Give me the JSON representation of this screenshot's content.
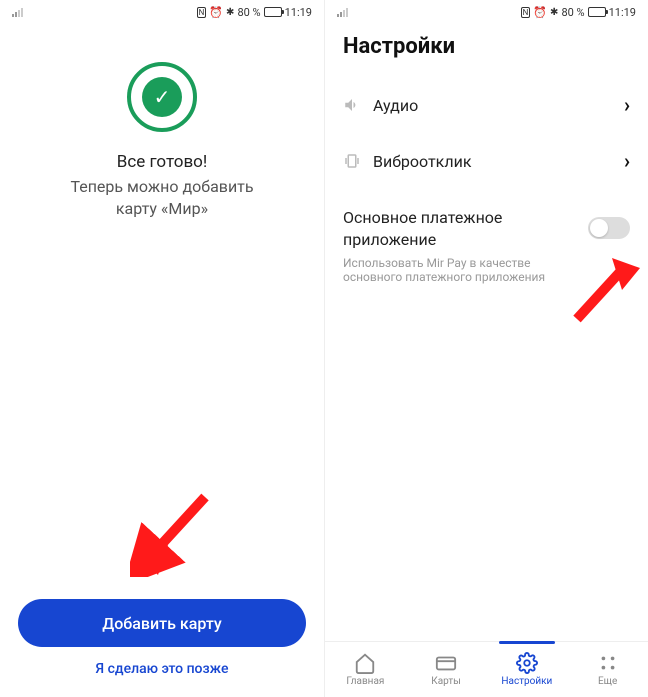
{
  "statusbar": {
    "battery_percent": "80 %",
    "time": "11:19"
  },
  "left": {
    "success_title": "Все готово!",
    "success_subtitle_line1": "Теперь можно добавить",
    "success_subtitle_line2": "карту «Мир»",
    "add_card_btn": "Добавить карту",
    "later_link": "Я сделаю это позже"
  },
  "right": {
    "title": "Настройки",
    "row_audio": "Аудио",
    "row_vibro": "Виброотклик",
    "toggle_title": "Основное платежное приложение",
    "toggle_desc": "Использовать Mir Pay в качестве основного платежного приложения",
    "toggle_on": false,
    "nav": {
      "home": "Главная",
      "cards": "Карты",
      "settings": "Настройки",
      "more": "Еще"
    }
  },
  "colors": {
    "primary": "#1746d1",
    "success": "#1a9d5a",
    "arrow": "#ff1a1a"
  }
}
